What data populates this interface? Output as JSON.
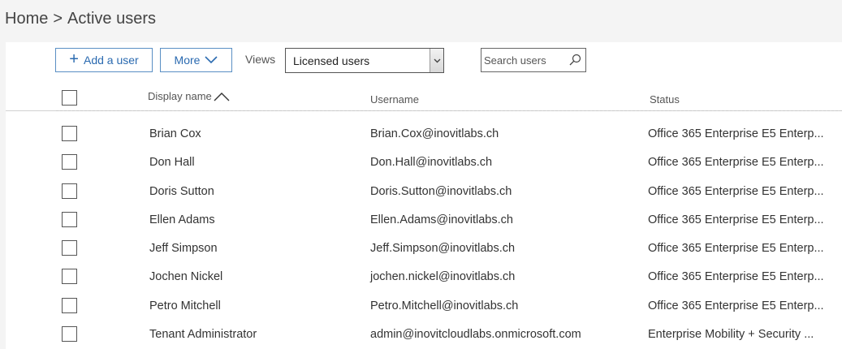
{
  "breadcrumb": {
    "home": "Home",
    "separator": ">",
    "current": "Active users"
  },
  "toolbar": {
    "add_user_label": "Add a user",
    "more_label": "More",
    "views_label": "Views",
    "views_selected": "Licensed users",
    "search_placeholder": "Search users"
  },
  "table": {
    "headers": {
      "display_name": "Display name",
      "username": "Username",
      "status": "Status"
    },
    "rows": [
      {
        "display_name": "Brian Cox",
        "username": "Brian.Cox@inovitlabs.ch",
        "status": "Office 365 Enterprise E5 Enterp..."
      },
      {
        "display_name": "Don Hall",
        "username": "Don.Hall@inovitlabs.ch",
        "status": "Office 365 Enterprise E5 Enterp..."
      },
      {
        "display_name": "Doris Sutton",
        "username": "Doris.Sutton@inovitlabs.ch",
        "status": "Office 365 Enterprise E5 Enterp..."
      },
      {
        "display_name": "Ellen Adams",
        "username": "Ellen.Adams@inovitlabs.ch",
        "status": "Office 365 Enterprise E5 Enterp..."
      },
      {
        "display_name": "Jeff Simpson",
        "username": "Jeff.Simpson@inovitlabs.ch",
        "status": "Office 365 Enterprise E5 Enterp..."
      },
      {
        "display_name": "Jochen Nickel",
        "username": "jochen.nickel@inovitlabs.ch",
        "status": "Office 365 Enterprise E5 Enterp..."
      },
      {
        "display_name": "Petro Mitchell",
        "username": "Petro.Mitchell@inovitlabs.ch",
        "status": "Office 365 Enterprise E5 Enterp..."
      },
      {
        "display_name": "Tenant Administrator",
        "username": "admin@inovitcloudlabs.onmicrosoft.com",
        "status": "Enterprise Mobility + Security ..."
      }
    ]
  },
  "colors": {
    "accent": "#2a6ab0",
    "page_bg": "#f4f4f4",
    "panel_bg": "#ffffff"
  }
}
